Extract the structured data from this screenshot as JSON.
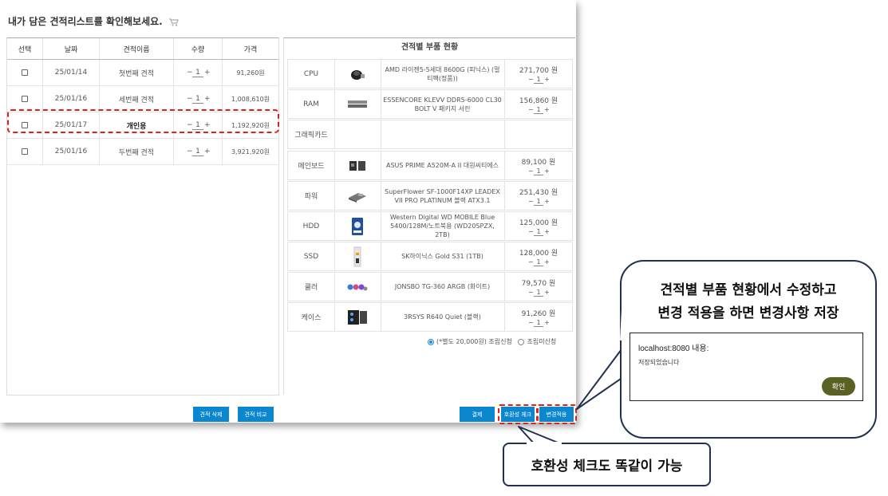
{
  "page": {
    "title": "내가 담은 견적리스트를 확인해보세요."
  },
  "estimate_table": {
    "headers": [
      "선택",
      "날짜",
      "견적이름",
      "수량",
      "가격"
    ],
    "rows": [
      {
        "date": "25/01/14",
        "name": "첫번째 견적",
        "qty": "1",
        "price": "91,260원"
      },
      {
        "date": "25/01/16",
        "name": "세번째 견적",
        "qty": "1",
        "price": "1,008,610원"
      },
      {
        "date": "25/01/17",
        "name": "개인용",
        "qty": "1",
        "price": "1,192,920원"
      },
      {
        "date": "25/01/16",
        "name": "두번째 견적",
        "qty": "1",
        "price": "3,921,920원"
      }
    ]
  },
  "parts": {
    "title": "견적별 부품 현황",
    "rows": [
      {
        "category": "CPU",
        "icon": "cpu-cooler-image",
        "name": "AMD 라이젠5-5세대 8600G (피닉스) (멀티팩(정품))",
        "price": "271,700 원",
        "qty": "1"
      },
      {
        "category": "RAM",
        "icon": "ram-stick-image",
        "name": "ESSENCORE KLEVV DDR5-6000 CL30 BOLT V 패키지 서린",
        "price": "156,860 원",
        "qty": "1"
      },
      {
        "category": "그래픽카드",
        "icon": "",
        "name": "",
        "price": "",
        "qty": ""
      },
      {
        "category": "메인보드",
        "icon": "motherboard-image",
        "name": "ASUS PRIME A520M-A II 대원씨티에스",
        "price": "89,100 원",
        "qty": "1"
      },
      {
        "category": "파워",
        "icon": "power-supply-image",
        "name": "SuperFlower SF-1000F14XP LEADEX VII PRO PLATINUM 블랙 ATX3.1",
        "price": "251,430 원",
        "qty": "1"
      },
      {
        "category": "HDD",
        "icon": "hdd-image",
        "name": "Western Digital WD MOBILE Blue 5400/128M/노트북용 (WD20SPZX, 2TB)",
        "price": "125,000 원",
        "qty": "1"
      },
      {
        "category": "SSD",
        "icon": "ssd-image",
        "name": "SK하이닉스 Gold S31 (1TB)",
        "price": "128,000 원",
        "qty": "1"
      },
      {
        "category": "쿨러",
        "icon": "cooler-fans-image",
        "name": "JONSBO TG-360 ARGB (화이트)",
        "price": "79,570 원",
        "qty": "1"
      },
      {
        "category": "케이스",
        "icon": "pc-case-image",
        "name": "3RSYS R640 Quiet (블랙)",
        "price": "91,260 원",
        "qty": "1"
      }
    ],
    "assembly_on": "(*별도 20,000원) 조립신청",
    "assembly_off": "조립미신청"
  },
  "buttons": {
    "delete": "견적 삭제",
    "compare": "견적 비교",
    "pay": "결제",
    "compat": "호환성 체크",
    "apply": "변경적용"
  },
  "callout1": {
    "line1": "견적별 부품 현황에서 수정하고",
    "line2": "변경 적용을 하면 변경사항 저장"
  },
  "alert": {
    "title": "localhost:8080 내용:",
    "message": "저장되었습니다",
    "ok": "확인"
  },
  "callout2": {
    "text": "호환성 체크도 똑같이 가능"
  },
  "colors": {
    "accent_blue": "#0b87d0",
    "highlight_red": "#e02020",
    "ok_button": "#5a6223",
    "callout_border": "#1f3050"
  }
}
